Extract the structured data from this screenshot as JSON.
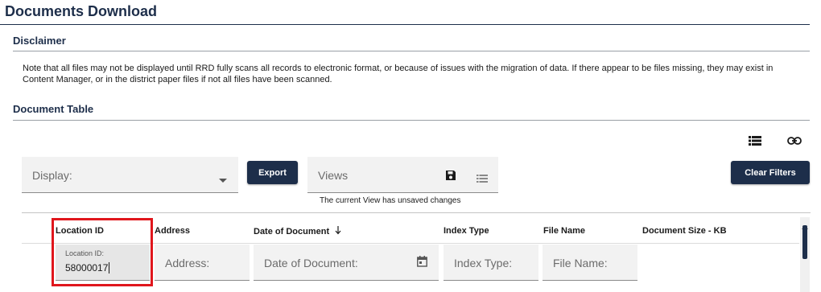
{
  "page": {
    "title": "Documents Download"
  },
  "disclaimer": {
    "heading": "Disclaimer",
    "text": "Note that all files may not be displayed until RRD fully scans all records to electronic format, or because of issues with the migration of data. If there appear to be files missing, they may exist in Content Manager, or in the district paper files if not all files have been scanned."
  },
  "document_table": {
    "heading": "Document Table",
    "display_label": "Display:",
    "export_label": "Export",
    "views_label": "Views",
    "views_note": "The current View has unsaved changes",
    "clear_filters_label": "Clear Filters",
    "columns": [
      "Location ID",
      "Address",
      "Date of Document",
      "Index Type",
      "File Name",
      "Document Size - KB"
    ],
    "filters": {
      "location_id_label": "Location ID:",
      "location_id_value": "58000017",
      "address_placeholder": "Address:",
      "date_placeholder": "Date of Document:",
      "index_type_placeholder": "Index Type:",
      "file_name_placeholder": "File Name:"
    }
  },
  "icons": [
    "list-view-icon",
    "link-icon",
    "dropdown-arrow-icon",
    "save-icon",
    "views-list-icon",
    "sort-down-arrow-icon",
    "calendar-icon"
  ],
  "colors": {
    "accent": "#1d2e4a",
    "highlight": "#e0161c",
    "field_bg": "#f2f2f2"
  }
}
